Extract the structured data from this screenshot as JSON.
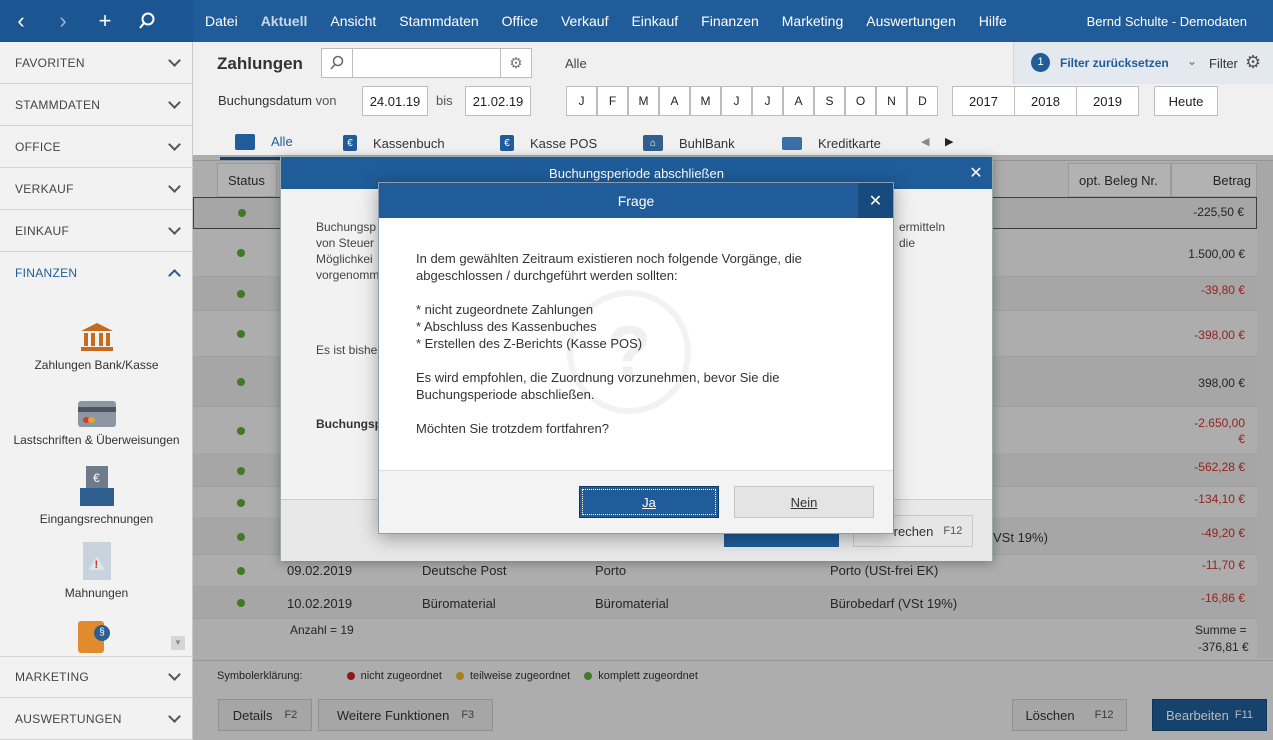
{
  "topbar": {
    "menu": [
      "Datei",
      "Aktuell",
      "Ansicht",
      "Stammdaten",
      "Office",
      "Verkauf",
      "Einkauf",
      "Finanzen",
      "Marketing",
      "Auswertungen",
      "Hilfe"
    ],
    "user": "Bernd Schulte - Demodaten"
  },
  "sidebar": {
    "sections": [
      "FAVORITEN",
      "STAMMDATEN",
      "OFFICE",
      "VERKAUF",
      "EINKAUF",
      "FINANZEN"
    ],
    "bottom_sections": [
      "MARKETING",
      "AUSWERTUNGEN"
    ],
    "items": [
      "Zahlungen Bank/Kasse",
      "Lastschriften & Überweisungen",
      "Eingangsrechnungen",
      "Mahnungen"
    ]
  },
  "page": {
    "title": "Zahlungen",
    "filter_all": "Alle",
    "filter_reset": "Filter zurücksetzen",
    "filter_badge": "1",
    "filter_label": "Filter",
    "booking_date_label": "Buchungsdatum",
    "from_label": "von",
    "to_label": "bis",
    "date_from": "24.01.19",
    "date_to": "21.02.19",
    "months": [
      "J",
      "F",
      "M",
      "A",
      "M",
      "J",
      "J",
      "A",
      "S",
      "O",
      "N",
      "D"
    ],
    "years": [
      "2017",
      "2018",
      "2019"
    ],
    "today": "Heute"
  },
  "tabs": [
    "Alle",
    "Kassenbuch",
    "Kasse POS",
    "BuhlBank",
    "Kreditkarte"
  ],
  "table": {
    "headers": {
      "status": "Status",
      "beleg": "opt. Beleg Nr.",
      "betrag": "Betrag"
    },
    "amounts": [
      "-225,50 €",
      "1.500,00 €",
      "-39,80 €",
      "-398,00 €",
      "398,00 €",
      "-2.650,00",
      "€",
      "-562,28 €",
      "-134,10 €",
      "-49,20 €",
      "-11,70 €",
      "-16,86 €"
    ],
    "rows": [
      {
        "date": "09.02.2019",
        "name": "Deutsche Post",
        "purpose": "Porto",
        "account": "Porto (USt-frei EK)"
      },
      {
        "date": "10.02.2019",
        "name": "Büromaterial",
        "purpose": "Büromaterial",
        "account": "Bürobedarf (VSt 19%)"
      }
    ],
    "partial_account": "VSt 19%)",
    "count": "Anzahl = 19",
    "sum_label": "Summe =",
    "sum_value": "-376,81 €"
  },
  "legend": {
    "label": "Symbolerklärung:",
    "items": [
      {
        "text": "nicht zugeordnet",
        "color": "#c0271d"
      },
      {
        "text": "teilweise zugeordnet",
        "color": "#e5b52a"
      },
      {
        "text": "komplett zugeordnet",
        "color": "#5aa832"
      }
    ]
  },
  "bottom": {
    "details": "Details",
    "details_key": "F2",
    "more": "Weitere Funktionen",
    "more_key": "F3",
    "delete": "Löschen",
    "delete_key": "F12",
    "edit": "Bearbeiten",
    "edit_key": "F11"
  },
  "dialog_back": {
    "title": "Buchungsperiode abschließen",
    "lines": [
      "Buchungsp",
      "von Steuer",
      "Möglichkei",
      "vorgenomm"
    ],
    "right_lines": [
      "ermitteln",
      "die"
    ],
    "line2": "Es ist bishe",
    "bold": "Buchungsp",
    "cancel_partial": "rechen",
    "cancel_key": "F12"
  },
  "dialog": {
    "title": "Frage",
    "intro": "In dem gewählten Zeitraum existieren noch folgende Vorgänge, die abgeschlossen / durchgeführt werden sollten:",
    "list": [
      "* nicht zugeordnete Zahlungen",
      "* Abschluss des Kassenbuches",
      "* Erstellen des Z-Berichts (Kasse POS)"
    ],
    "recommend": "Es wird empfohlen, die Zuordnung vorzunehmen, bevor Sie die Buchungsperiode abschließen.",
    "question": "Möchten Sie trotzdem fortfahren?",
    "yes": "Ja",
    "no": "Nein"
  },
  "colors": {
    "brand": "#1f5c99",
    "negative": "#d0302a",
    "ok": "#5aa832"
  }
}
